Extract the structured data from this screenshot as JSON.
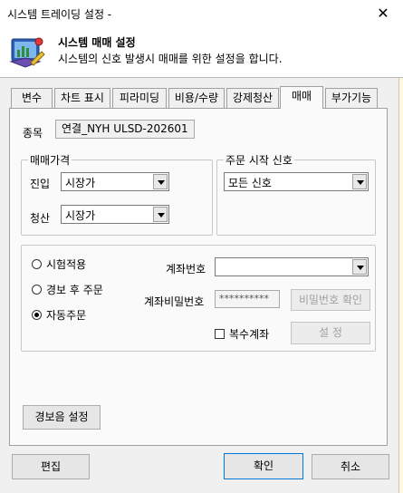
{
  "window": {
    "title": "시스템 트레이딩 설정 -",
    "close_glyph": "✕"
  },
  "header": {
    "title": "시스템 매매 설정",
    "description": "시스템의 신호 발생시 매매를 위한 설정을 합니다."
  },
  "tabs": [
    {
      "label": "변수"
    },
    {
      "label": "차트 표시"
    },
    {
      "label": "피라미딩"
    },
    {
      "label": "비용/수량"
    },
    {
      "label": "강제청산"
    },
    {
      "label": "매매"
    },
    {
      "label": "부가기능"
    }
  ],
  "active_tab": "매매",
  "symbol": {
    "label": "종목",
    "value": "연결_NYH ULSD-202601"
  },
  "order_price": {
    "legend": "매매가격",
    "entry_label": "진입",
    "entry_value": "시장가",
    "exit_label": "청산",
    "exit_value": "시장가"
  },
  "order_signal": {
    "legend": "주문 시작 신호",
    "value": "모든 신호"
  },
  "mode": {
    "options": [
      "시험적용",
      "경보 후 주문",
      "자동주문"
    ],
    "selected": "자동주문"
  },
  "account": {
    "number_label": "계좌번호",
    "number_value": "",
    "password_label": "계좌비밀번호",
    "password_value": "**********",
    "verify_button": "비밀번호 확인",
    "multi_label": "복수계좌",
    "multi_checked": false,
    "setup_button": "설  정"
  },
  "alert_sound_button": "경보음 설정",
  "footer": {
    "edit": "편집",
    "ok": "확인",
    "cancel": "취소"
  },
  "icons": {
    "header": "settings-chart-icon",
    "combo": "chevron-down-icon"
  }
}
